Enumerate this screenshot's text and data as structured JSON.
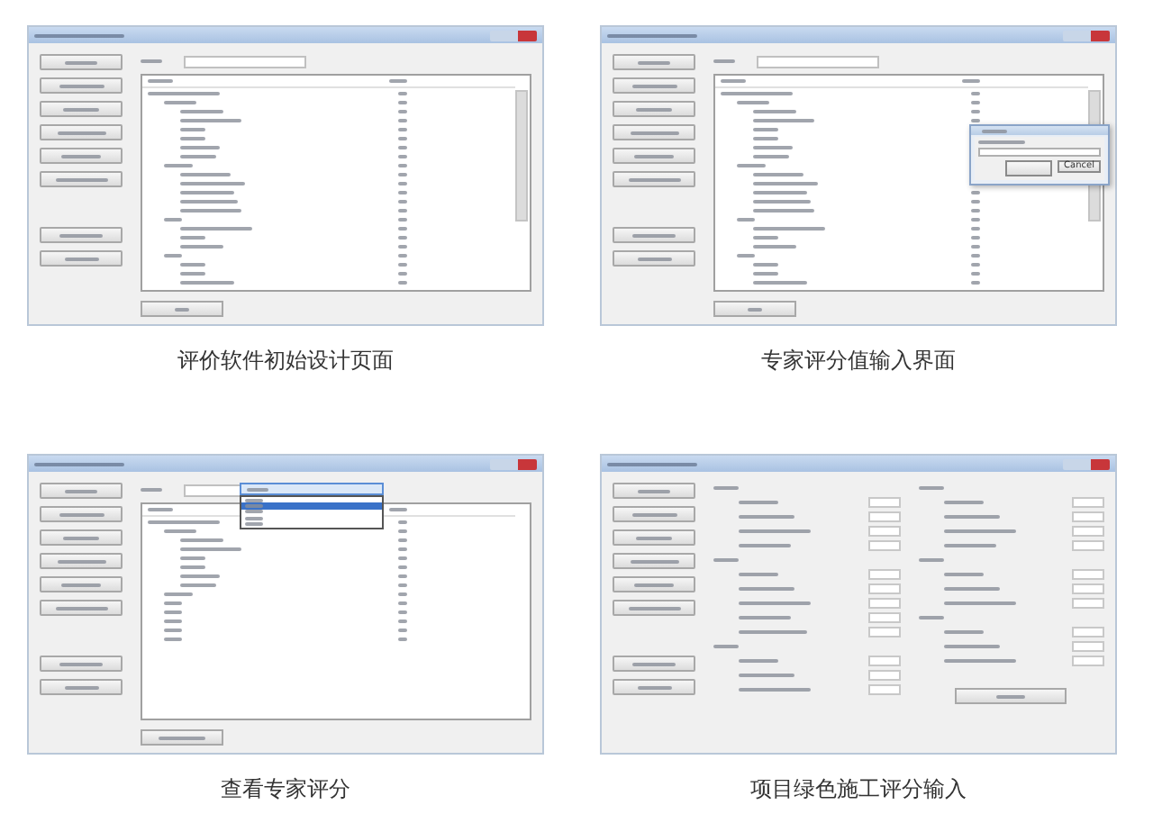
{
  "panels": [
    {
      "kind": "tree",
      "caption": "评价软件初始设计页面"
    },
    {
      "kind": "dialog",
      "caption": "专家评分值输入界面",
      "dialog_cancel": "Cancel"
    },
    {
      "kind": "dropdown",
      "caption": "查看专家评分"
    },
    {
      "kind": "form",
      "caption": "项目绿色施工评分输入"
    }
  ]
}
